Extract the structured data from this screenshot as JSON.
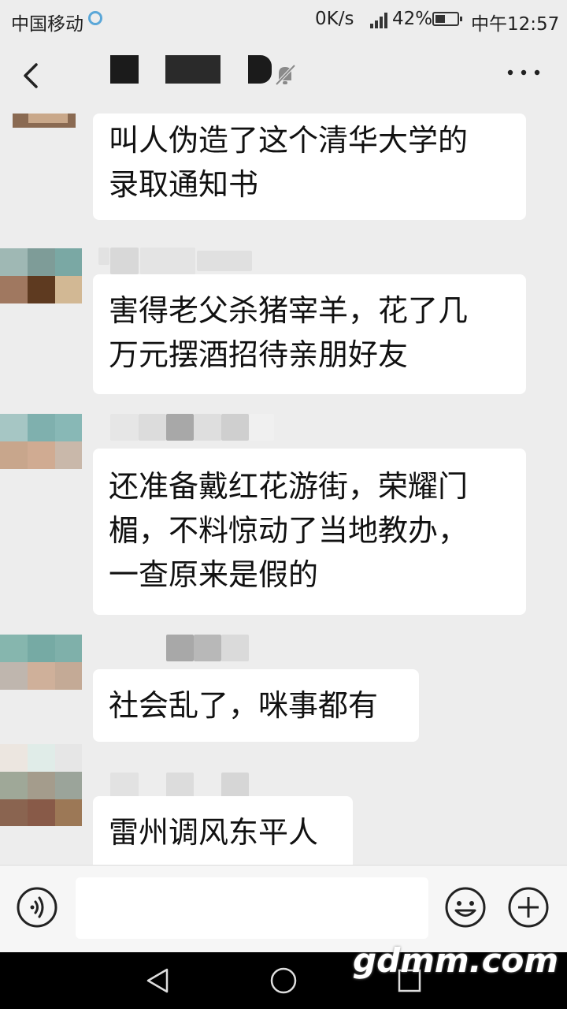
{
  "status_bar": {
    "carrier": "中国移动",
    "network_speed": "0K/s",
    "battery": "42%",
    "time": "中午12:57"
  },
  "header": {
    "back_icon": "chevron-left-icon",
    "mute_icon": "bell-off-icon",
    "more_icon": "more-dots-icon"
  },
  "messages": [
    {
      "text": "叫人伪造了这个清华大学的\n录取通知书"
    },
    {
      "text": "害得老父杀猪宰羊，花了几\n万元摆酒招待亲朋好友"
    },
    {
      "text": "还准备戴红花游街，荣耀门\n楣，不料惊动了当地教办，\n一查原来是假的"
    },
    {
      "text": "社会乱了，咪事都有"
    },
    {
      "text": "雷州调风东平人"
    }
  ],
  "input_bar": {
    "placeholder": "",
    "voice_icon": "voice-icon",
    "emoji_icon": "emoji-icon",
    "plus_icon": "plus-icon"
  },
  "watermark": "gdmm.com",
  "colors": {
    "background": "#ededed",
    "bubble": "#ffffff",
    "nav_bar": "#000000"
  }
}
